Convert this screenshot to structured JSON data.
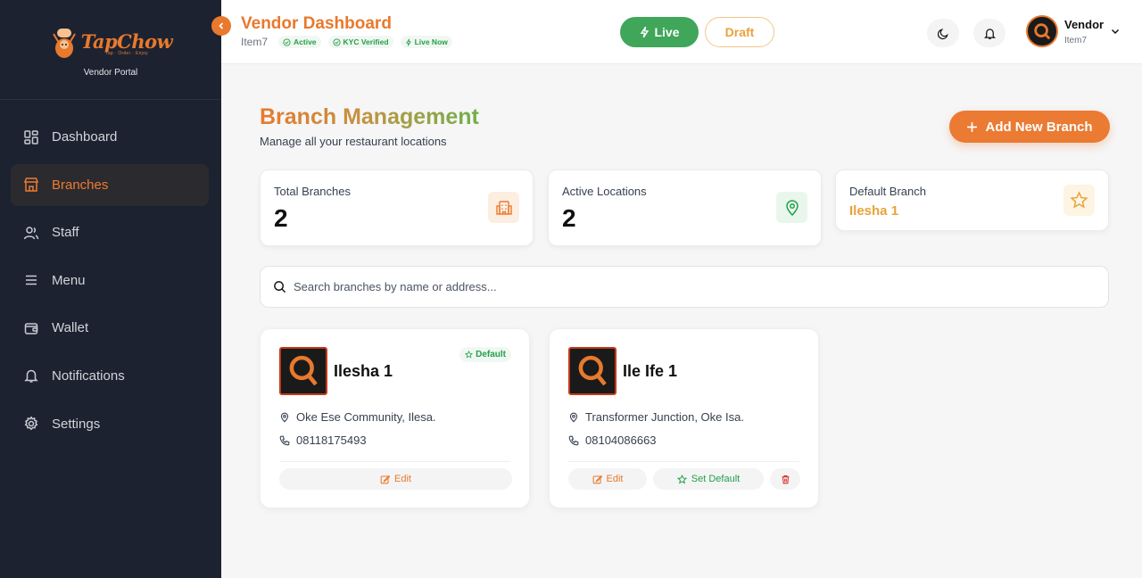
{
  "sidebar": {
    "brand_name": "TapChow",
    "brand_tagline": "Tap · Order · Enjoy",
    "brand_subtitle": "Vendor Portal",
    "items": [
      {
        "label": "Dashboard",
        "icon": "dashboard-icon",
        "active": false
      },
      {
        "label": "Branches",
        "icon": "store-icon",
        "active": true
      },
      {
        "label": "Staff",
        "icon": "users-icon",
        "active": false
      },
      {
        "label": "Menu",
        "icon": "menu-icon",
        "active": false
      },
      {
        "label": "Wallet",
        "icon": "wallet-icon",
        "active": false
      },
      {
        "label": "Notifications",
        "icon": "bell-icon",
        "active": false
      },
      {
        "label": "Settings",
        "icon": "gear-icon",
        "active": false
      }
    ]
  },
  "header": {
    "title": "Vendor Dashboard",
    "store": "Item7",
    "chips": [
      "Active",
      "KYC Verified",
      "Live Now"
    ],
    "live_label": "Live",
    "draft_label": "Draft",
    "user_name": "Vendor",
    "user_sub": "Item7"
  },
  "main": {
    "title": "Branch Management",
    "subtitle": "Manage all your restaurant locations",
    "add_button": "Add New Branch",
    "stats": {
      "total_label": "Total Branches",
      "total_value": "2",
      "active_label": "Active Locations",
      "active_value": "2",
      "default_label": "Default Branch",
      "default_value": "Ilesha 1"
    },
    "search_placeholder": "Search branches by name or address...",
    "branches": [
      {
        "name": "Ilesha 1",
        "address": "Oke Ese Community, Ilesa.",
        "phone": "08118175493",
        "is_default": true,
        "default_badge": "Default",
        "edit_label": "Edit"
      },
      {
        "name": "Ile Ife 1",
        "address": "Transformer Junction, Oke Isa.",
        "phone": "08104086663",
        "is_default": false,
        "edit_label": "Edit",
        "set_default_label": "Set Default"
      }
    ]
  },
  "colors": {
    "accent": "#e8792d",
    "sidebar_bg": "#1c2230",
    "success": "#22a04a",
    "live_button": "#3fa65a",
    "warning": "#e9a23a",
    "danger": "#dc2626"
  }
}
